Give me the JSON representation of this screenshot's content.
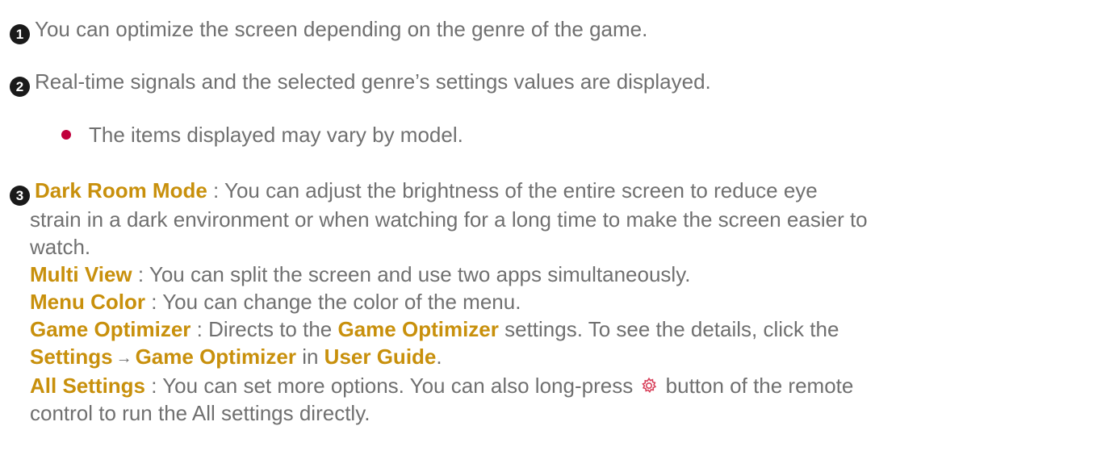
{
  "item1": {
    "number": "1",
    "text": "You can optimize the screen depending on the genre of the game."
  },
  "item2": {
    "number": "2",
    "text": "Real-time signals and the selected genre’s settings values are displayed."
  },
  "note": {
    "text": "The items displayed may vary by model."
  },
  "item3": {
    "number": "3",
    "dark_room": {
      "term": "Dark Room Mode",
      "line1": " : You can adjust the brightness of the entire screen to reduce eye",
      "line2": "strain in a dark environment or when watching for a long time to make the screen easier to",
      "line3": "watch."
    },
    "multi_view": {
      "term": "Multi View",
      "desc": " : You can split the screen and use two apps simultaneously."
    },
    "menu_color": {
      "term": "Menu Color",
      "desc": " : You can change the color of the menu."
    },
    "game_optimizer": {
      "term": "Game Optimizer",
      "desc_a": " : Directs to the ",
      "term2": "Game Optimizer",
      "desc_b": " settings. To see the details, click the",
      "settings": "Settings",
      "arrow": "→",
      "term3": "Game Optimizer",
      "in": " in ",
      "user_guide": "User Guide",
      "period": "."
    },
    "all_settings": {
      "term": "All Settings",
      "desc_a": " : You can set more options. You can also long-press ",
      "icon": "gear-icon",
      "desc_b": " button of the remote",
      "line2": "control to run the All settings directly."
    }
  },
  "colors": {
    "body_text": "#707070",
    "highlight": "#c8900c",
    "bullet": "#c0003c",
    "number_badge": "#1a1a1a"
  }
}
